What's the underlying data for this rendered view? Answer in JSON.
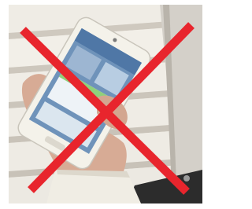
{
  "image": {
    "kind": "photo",
    "subject": "hand-holding-smartphone-on-stairs",
    "overlay": "red-x-cross-mark"
  },
  "colors": {
    "frame": "#ffffff",
    "stairs_light": "#f1eee7",
    "stairs_shadow": "#cfcac0",
    "wall": "#d9d6d0",
    "phone_body": "#f4f2ea",
    "phone_screen": "#6b8fb6",
    "screen_panel": "#8fd07b",
    "skin": "#d8ad98",
    "sleeve": "#f0ede4",
    "dark_cloth": "#2c2c2c",
    "cross_red": "#e8252d"
  },
  "icons": {
    "cross_mark": "prohibition-x-icon"
  }
}
